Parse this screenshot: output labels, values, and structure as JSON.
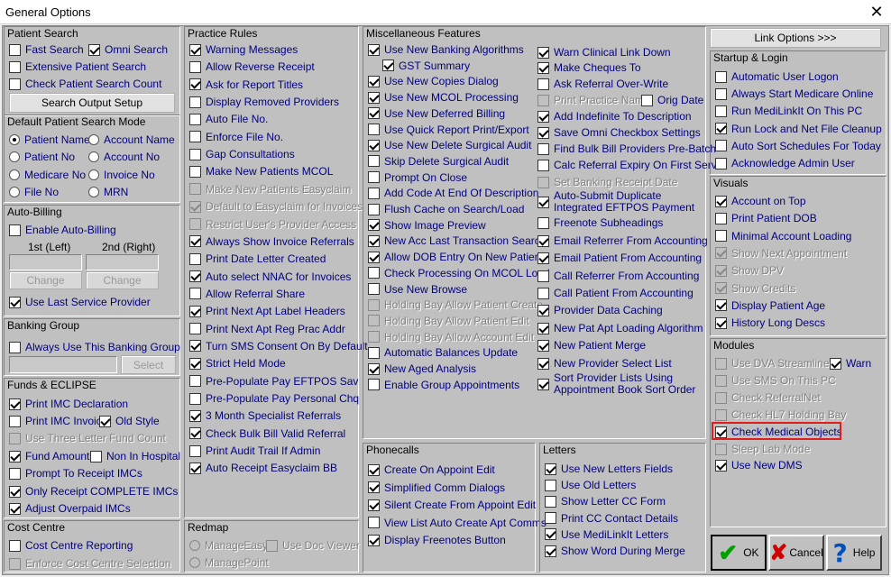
{
  "window": {
    "title": "General Options",
    "close": "✕"
  },
  "patient_search": {
    "title": "Patient Search",
    "fast": "Fast Search",
    "omni": "Omni Search",
    "extensive": "Extensive Patient Search",
    "count": "Check Patient Search Count",
    "setup": "Search Output Setup"
  },
  "default_mode": {
    "title": "Default Patient Search Mode",
    "patient_name": "Patient Name",
    "account_name": "Account Name",
    "patient_no": "Patient No",
    "account_no": "Account No",
    "medicare_no": "Medicare No",
    "invoice_no": "Invoice No",
    "file_no": "File No",
    "mrn": "MRN"
  },
  "auto_billing": {
    "title": "Auto-Billing",
    "enable": "Enable Auto-Billing",
    "first": "1st (Left)",
    "second": "2nd (Right)",
    "change1": "Change",
    "change2": "Change",
    "last_provider": "Use Last Service Provider"
  },
  "banking": {
    "title": "Banking Group",
    "always": "Always Use This Banking Group",
    "select": "Select"
  },
  "funds": {
    "title": "Funds & ECLIPSE",
    "print_imc": "Print IMC Declaration",
    "print_imc_inv": "Print IMC Invoice",
    "old_style": "Old Style",
    "three_letter": "Use Three Letter Fund Count",
    "fund_amount": "Fund Amount",
    "non_hosp": "Non In Hospital",
    "prompt": "Prompt To Receipt IMCs",
    "only_complete": "Only Receipt COMPLETE IMCs",
    "adjust": "Adjust Overpaid IMCs"
  },
  "cost_centre": {
    "title": "Cost Centre",
    "reporting": "Cost Centre Reporting",
    "enforce": "Enforce Cost Centre Selection"
  },
  "practice": {
    "title": "Practice Rules",
    "items": [
      "Warning Messages",
      "Allow Reverse Receipt",
      "Ask for Report Titles",
      "Display Removed Providers",
      "Auto File No.",
      "Enforce File No.",
      "Gap Consultations",
      "Make New Patients MCOL",
      "Make New Patients Easyclaim",
      "Default to Easyclaim for Invoices",
      "Restrict User's Provider Access",
      "Always Show Invoice Referrals",
      "Print Date Letter Created",
      "Auto select NNAC for Invoices",
      "Allow Referral Share",
      "Print Next Apt Label Headers",
      "Print Next Apt Reg Prac Addr",
      "Turn SMS Consent On By Default",
      "Strict Held Mode",
      "Pre-Populate Pay EFTPOS Sav",
      "Pre-Populate Pay Personal Chq",
      "3 Month Specialist Referrals",
      "Check Bulk Bill Valid Referral",
      "Print Audit Trail If Admin",
      "Auto Receipt Easyclaim BB"
    ]
  },
  "redmap": {
    "title": "Redmap",
    "manage_easy": "ManageEasy",
    "use_doc": "Use Doc Viewer",
    "manage_point": "ManagePoint"
  },
  "misc": {
    "title": "Miscellaneous Features",
    "left": [
      "Use New Banking Algorithms",
      "GST Summary",
      "Use New Copies Dialog",
      "Use New MCOL Processing",
      "Use New Deferred Billing",
      "Use Quick Report Print/Export",
      "Use New Delete Surgical Audit",
      "Skip Delete Surgical Audit",
      "Prompt On Close",
      "Add Code At End Of Description",
      "Flush Cache on Search/Load",
      "Show Image Preview",
      "New Acc Last Transaction Search",
      "Allow DOB Entry On New Patient",
      "Check Processing On MCOL Load",
      "Use New Browse",
      "Holding Bay Allow Patient Create",
      "Holding Bay Allow Patient Edit",
      "Holding Bay Allow Account Edit",
      "Automatic Balances Update",
      "New Aged Analysis",
      "Enable Group Appointments"
    ],
    "right": [
      "Warn Clinical Link Down",
      "Make Cheques To",
      "Ask Referral Over-Write",
      "Print Practice Name",
      "Orig Date",
      "Add Indefinite To Description",
      "Save Omni Checkbox Settings",
      "Find Bulk Bill Providers Pre-Batch",
      "Calc Referral Expiry On First Serv",
      "Set Banking Receipt Date",
      "Auto-Submit Duplicate",
      "Integrated EFTPOS Payment",
      "Freenote Subheadings",
      "Email Referrer From Accounting",
      "Email Patient From Accounting",
      "Call Referrer From Accounting",
      "Call Patient From Accounting",
      "Provider Data Caching",
      "New Pat Apt Loading Algorithm",
      "New Patient Merge",
      "New Provider Select List",
      "Sort Provider Lists Using",
      "Appointment Book Sort Order"
    ]
  },
  "phonecalls": {
    "title": "Phonecalls",
    "items": [
      "Create On Appoint Edit",
      "Simplified Comm Dialogs",
      "Silent Create From Appoint Edit",
      "View List Auto Create Apt Comms",
      "Display Freenotes Button"
    ]
  },
  "letters": {
    "title": "Letters",
    "items": [
      "Use New Letters Fields",
      "Use Old Letters",
      "Show Letter CC Form",
      "Print CC Contact Details",
      "Use MediLinkIt Letters",
      "Show Word During Merge"
    ]
  },
  "link_options": "Link Options >>>",
  "startup": {
    "title": "Startup & Login",
    "items": [
      "Automatic User Logon",
      "Always Start Medicare Online",
      "Run MediLinkIt On This PC",
      "Run Lock and Net File Cleanup",
      "Auto Sort Schedules For Today",
      "Acknowledge Admin User"
    ]
  },
  "visuals": {
    "title": "Visuals",
    "items": [
      "Account on Top",
      "Print Patient DOB",
      "Minimal Account Loading",
      "Show Next Appointment",
      "Show DPV",
      "Show Credits",
      "Display Patient Age",
      "History Long Descs"
    ]
  },
  "modules": {
    "title": "Modules",
    "items": [
      "Use DVA Streamlined",
      "Warn",
      "Use SMS On This PC",
      "Check ReferralNet",
      "Check HL7 Holding Bay",
      "Check Medical Objects",
      "Sleep Lab Mode",
      "Use New DMS"
    ]
  },
  "buttons": {
    "ok": "OK",
    "cancel": "Cancel",
    "help": "Help"
  }
}
